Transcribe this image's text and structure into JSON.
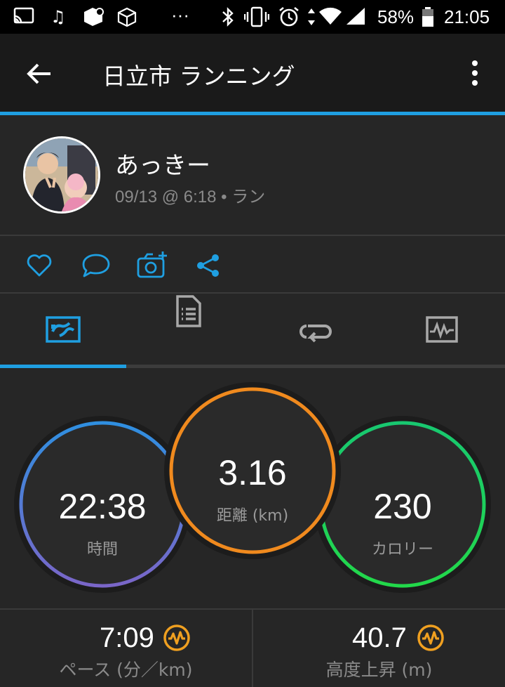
{
  "status_bar": {
    "battery": "58%",
    "time": "21:05",
    "more": "···"
  },
  "app_bar": {
    "title": "日立市 ランニング",
    "back_icon": "arrow-left-icon",
    "menu_icon": "more-vert-icon"
  },
  "profile": {
    "name": "あっきー",
    "meta": "09/13 @ 6:18 • ラン"
  },
  "actions": [
    "heart-icon",
    "comment-icon",
    "add-photo-icon",
    "share-icon"
  ],
  "tabs": [
    {
      "icon": "summary-map-icon",
      "selected": true
    },
    {
      "icon": "details-list-icon",
      "selected": false
    },
    {
      "icon": "laps-loop-icon",
      "selected": false
    },
    {
      "icon": "charts-icon",
      "selected": false
    }
  ],
  "stats": {
    "time": {
      "value": "22:38",
      "label": "時間"
    },
    "distance": {
      "value": "3.16",
      "label": "距離 (km)"
    },
    "calories": {
      "value": "230",
      "label": "カロリー"
    }
  },
  "bottom": {
    "pace": {
      "value": "7:09",
      "label": "ペース (分／km)"
    },
    "elevation": {
      "value": "40.7",
      "label": "高度上昇 (m)"
    }
  },
  "colors": {
    "accent": "#1f9fe1",
    "time_ring": [
      "#2f8fe0",
      "#7a66c8"
    ],
    "distance_ring": "#f08a1e",
    "calories_ring": [
      "#18c870",
      "#22d84a"
    ],
    "badge_orange": "#f0a020"
  }
}
